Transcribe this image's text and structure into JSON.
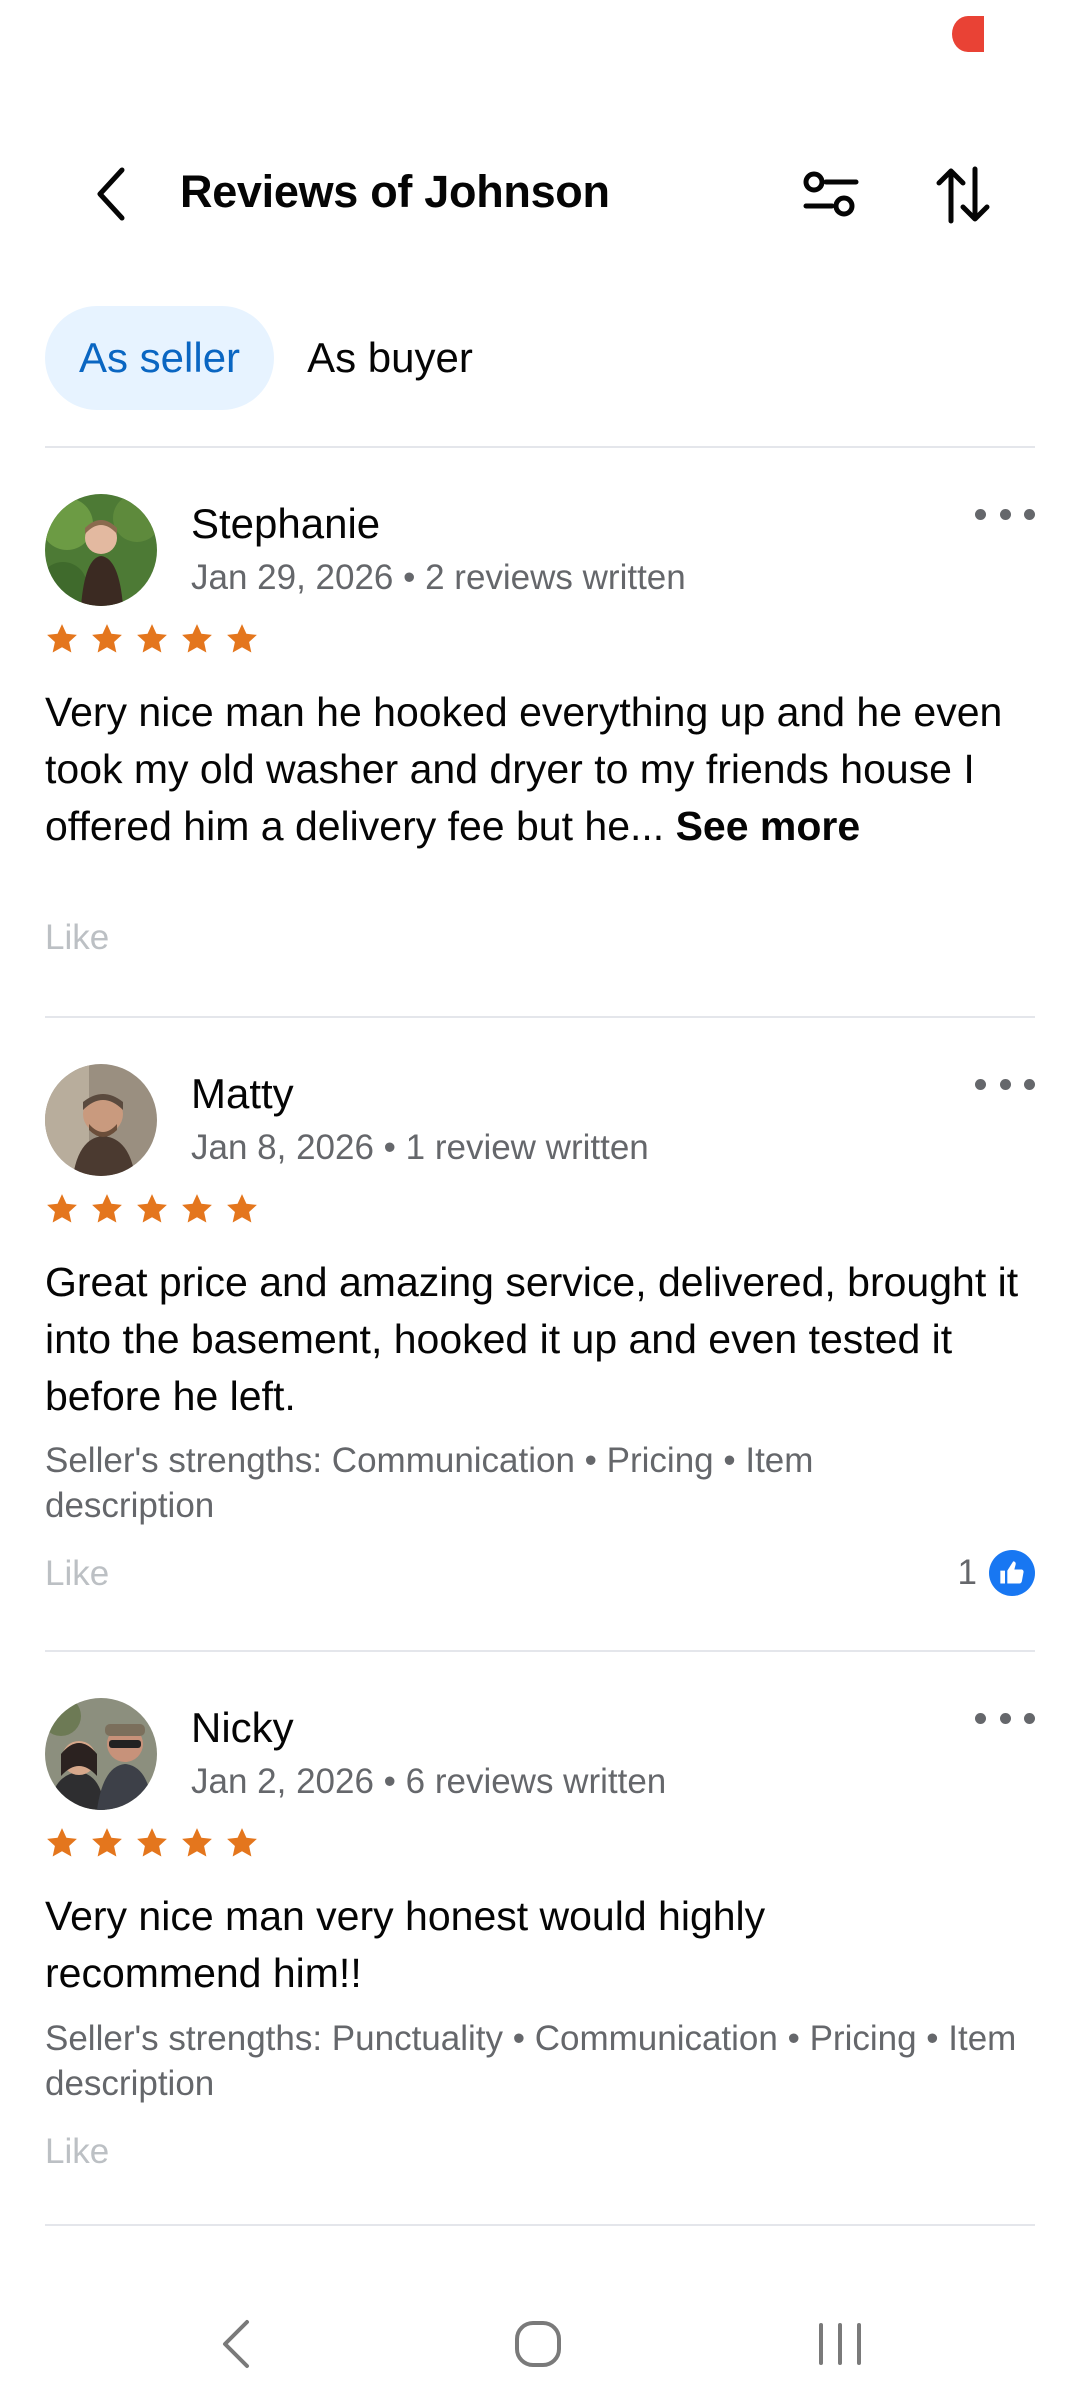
{
  "header": {
    "title": "Reviews of Johnson"
  },
  "tabs": [
    {
      "label": "As seller",
      "active": true
    },
    {
      "label": "As buyer",
      "active": false
    }
  ],
  "reviews": [
    {
      "name": "Stephanie",
      "meta": "Jan 29, 2026 • 2 reviews written",
      "rating": 5,
      "text": "Very nice man he hooked everything up and he even took my old washer and dryer to my friends house I offered him a delivery fee but he...",
      "see_more": "See more",
      "like_label": "Like"
    },
    {
      "name": "Matty",
      "meta": "Jan 8, 2026 • 1 review written",
      "rating": 5,
      "text": "Great price and amazing service, delivered, brought it into the basement, hooked it up and even tested it before he left.",
      "strengths": "Seller's strengths: Communication • Pricing • Item description",
      "like_label": "Like",
      "like_count": "1"
    },
    {
      "name": "Nicky",
      "meta": "Jan 2, 2026 • 6 reviews written",
      "rating": 5,
      "text": "Very nice man very honest would highly recommend him!!",
      "strengths": "Seller's strengths: Punctuality • Communication • Pricing • Item description",
      "like_label": "Like"
    }
  ],
  "colors": {
    "accent": "#0a66c2",
    "tab_bg": "#e7f3ff",
    "star": "#e4761d",
    "like_blue": "#1877f2",
    "record_dot": "#e94235"
  },
  "icons": [
    "back-arrow-icon",
    "filter-sliders-icon",
    "sort-arrows-icon",
    "more-dots-icon",
    "star-icon",
    "thumbs-up-icon",
    "nav-back-icon",
    "nav-home-icon",
    "nav-recents-icon"
  ]
}
